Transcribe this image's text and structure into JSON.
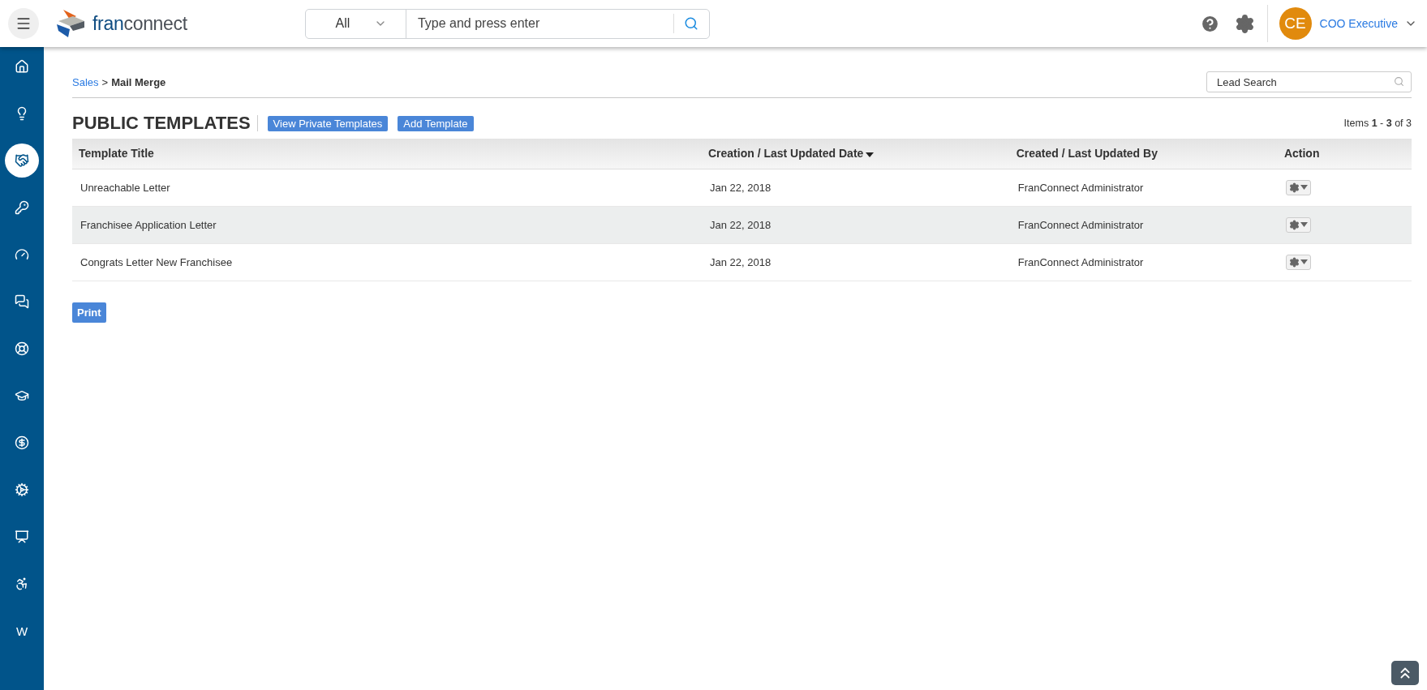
{
  "header": {
    "logo_text": [
      "fran",
      "connect"
    ],
    "search": {
      "scope": "All",
      "placeholder": "Type and press enter"
    },
    "user": {
      "initials": "CE",
      "name": "COO Executive"
    }
  },
  "sidebar": {
    "items": [
      {
        "selected": false
      },
      {
        "selected": false
      },
      {
        "selected": true
      },
      {
        "selected": false
      },
      {
        "selected": false
      },
      {
        "selected": false
      },
      {
        "selected": false
      },
      {
        "selected": false
      },
      {
        "selected": false
      },
      {
        "selected": false
      },
      {
        "selected": false
      },
      {
        "selected": false
      },
      {
        "selected": false,
        "label": "W"
      }
    ]
  },
  "breadcrumb": {
    "link": "Sales",
    "separator": ">",
    "current": "Mail Merge"
  },
  "lead_search": {
    "placeholder": "Lead Search"
  },
  "title": "PUBLIC TEMPLATES",
  "actions": [
    "View Private Templates",
    "Add Template"
  ],
  "pagination": "Items **1** - **3** of 3",
  "table": {
    "columns": [
      {
        "label": "Template Title",
        "sorted": false
      },
      {
        "label": "Creation / Last Updated Date",
        "sorted": true
      },
      {
        "label": "Created / Last Updated By",
        "sorted": false
      },
      {
        "label": "Action",
        "sorted": false
      }
    ],
    "rows": [
      {
        "title": "Unreachable Letter",
        "date": "Jan 22, 2018",
        "by": "FranConnect Administrator"
      },
      {
        "title": "Franchisee Application Letter",
        "date": "Jan 22, 2018",
        "by": "FranConnect Administrator"
      },
      {
        "title": "Congrats Letter New Franchisee",
        "date": "Jan 22, 2018",
        "by": "FranConnect Administrator"
      }
    ]
  },
  "print_button": "Print"
}
